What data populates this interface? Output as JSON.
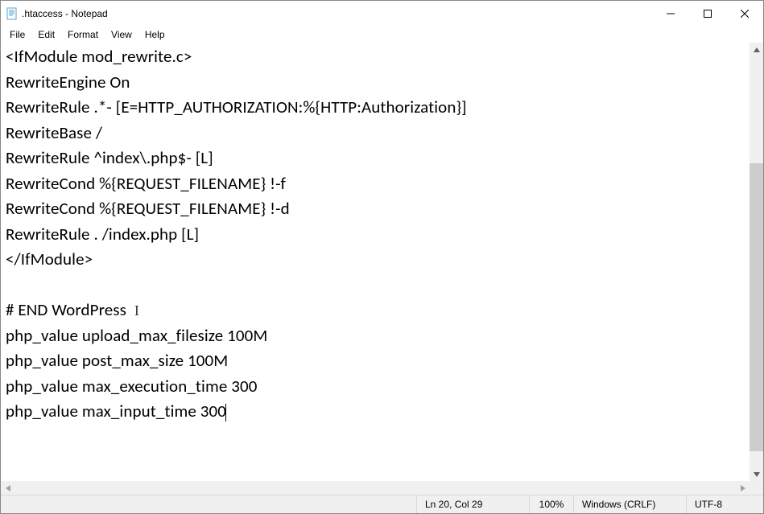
{
  "window": {
    "title": ".htaccess - Notepad"
  },
  "menu": {
    "file": "File",
    "edit": "Edit",
    "format": "Format",
    "view": "View",
    "help": "Help"
  },
  "editor": {
    "lines": [
      "<IfModule mod_rewrite.c>",
      "RewriteEngine On",
      "RewriteRule .*- [E=HTTP_AUTHORIZATION:%{HTTP:Authorization}]",
      "RewriteBase /",
      "RewriteRule ^index\\.php$- [L]",
      "RewriteCond %{REQUEST_FILENAME} !-f",
      "RewriteCond %{REQUEST_FILENAME} !-d",
      "RewriteRule . /index.php [L]",
      "</IfModule>",
      "",
      "# END WordPress",
      "php_value upload_max_filesize 100M",
      "php_value post_max_size 100M",
      "php_value max_execution_time 300",
      "php_value max_input_time 300"
    ],
    "caret_after_line_index": 14,
    "ibeam_after_line_index": 10
  },
  "scrollbar": {
    "thumb_top_pct": 26,
    "thumb_height_pct": 70
  },
  "status": {
    "position": "Ln 20, Col 29",
    "zoom": "100%",
    "line_ending": "Windows (CRLF)",
    "encoding": "UTF-8"
  }
}
